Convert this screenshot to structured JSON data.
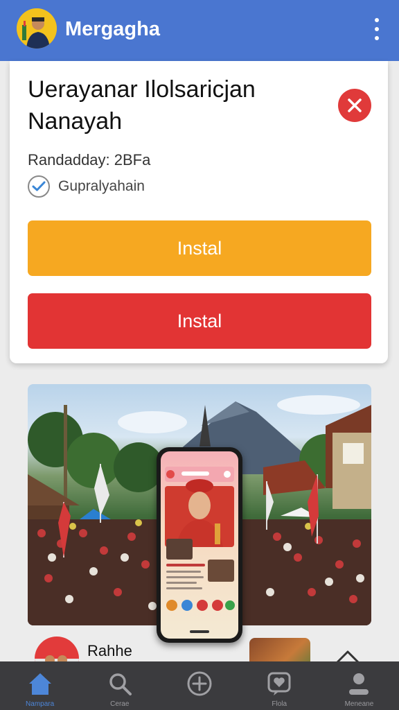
{
  "app_bar": {
    "title": "Mergagha",
    "brand_color": "#4a76d0",
    "menu_icon": "more-vertical-icon"
  },
  "install_card": {
    "title": "Uerayanar Ilolsaricjan Nanayah",
    "meta": "Randadday: 2BFa",
    "verified_label": "Gupralyahain",
    "primary_button": "Instal",
    "secondary_button": "Instal",
    "colors": {
      "primary": "#f6a821",
      "secondary": "#e23434",
      "close": "#e03a3a"
    }
  },
  "list_preview": {
    "name": "Rahhe"
  },
  "bottom_nav": {
    "items": [
      {
        "label": "Nampara",
        "icon": "home-icon",
        "active": true
      },
      {
        "label": "Cerae",
        "icon": "search-icon",
        "active": false
      },
      {
        "label": "",
        "icon": "add-circle-icon",
        "active": false
      },
      {
        "label": "Flola",
        "icon": "heart-chat-icon",
        "active": false
      },
      {
        "label": "Meneane",
        "icon": "profile-icon",
        "active": false
      }
    ],
    "active_color": "#4d86d8"
  }
}
